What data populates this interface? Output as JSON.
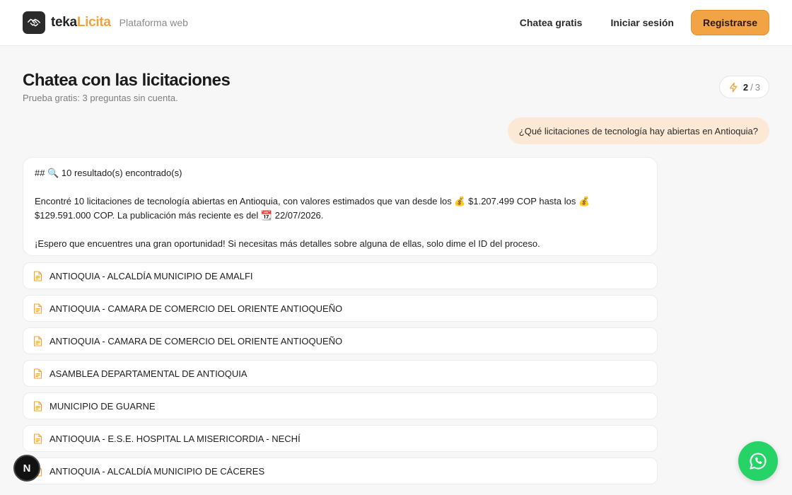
{
  "header": {
    "brand_prefix": "teka",
    "brand_suffix": "Licita",
    "platform": "Plataforma web",
    "nav_chat": "Chatea gratis",
    "nav_login": "Iniciar sesión",
    "nav_register": "Registrarse",
    "logo_icon": "handshake-icon"
  },
  "main": {
    "title": "Chatea con las licitaciones",
    "subtitle": "Prueba gratis: 3 preguntas sin cuenta.",
    "quota": {
      "used": "2",
      "separator": "/",
      "total": "3",
      "icon": "lightning-icon"
    }
  },
  "chat": {
    "user_question": "¿Qué licitaciones de tecnología hay abiertas en Antioquia?",
    "answer": {
      "heading": "## 🔍 10 resultado(s) encontrado(s)",
      "line1": "Encontré 10 licitaciones de tecnología abiertas en Antioquia, con valores estimados que van desde los 💰 $1.207.499 COP hasta los 💰",
      "line2": "$129.591.000 COP. La publicación más reciente es del 📆 22/07/2026.",
      "line3": "¡Espero que encuentres una gran oportunidad! Si necesitas más detalles sobre alguna de ellas, solo dime el ID del proceso."
    },
    "results": [
      {
        "name": "ANTIOQUIA - ALCALDÍA MUNICIPIO DE AMALFI"
      },
      {
        "name": "ANTIOQUIA - CAMARA DE COMERCIO DEL ORIENTE ANTIOQUEÑO"
      },
      {
        "name": "ANTIOQUIA - CAMARA DE COMERCIO DEL ORIENTE ANTIOQUEÑO"
      },
      {
        "name": "ASAMBLEA DEPARTAMENTAL DE ANTIOQUIA"
      },
      {
        "name": "MUNICIPIO DE GUARNE"
      },
      {
        "name": "ANTIOQUIA - E.S.E. HOSPITAL LA MISERICORDIA - NECHÍ"
      },
      {
        "name": "ANTIOQUIA - ALCALDÍA MUNICIPIO DE CÁCERES"
      }
    ]
  },
  "floating": {
    "next_badge": "N",
    "whatsapp_icon": "whatsapp-icon"
  },
  "colors": {
    "accent": "#f2a444",
    "user_bubble": "#fbe9d6",
    "whatsapp": "#25d366",
    "doc_icon": "#f2a23a"
  }
}
